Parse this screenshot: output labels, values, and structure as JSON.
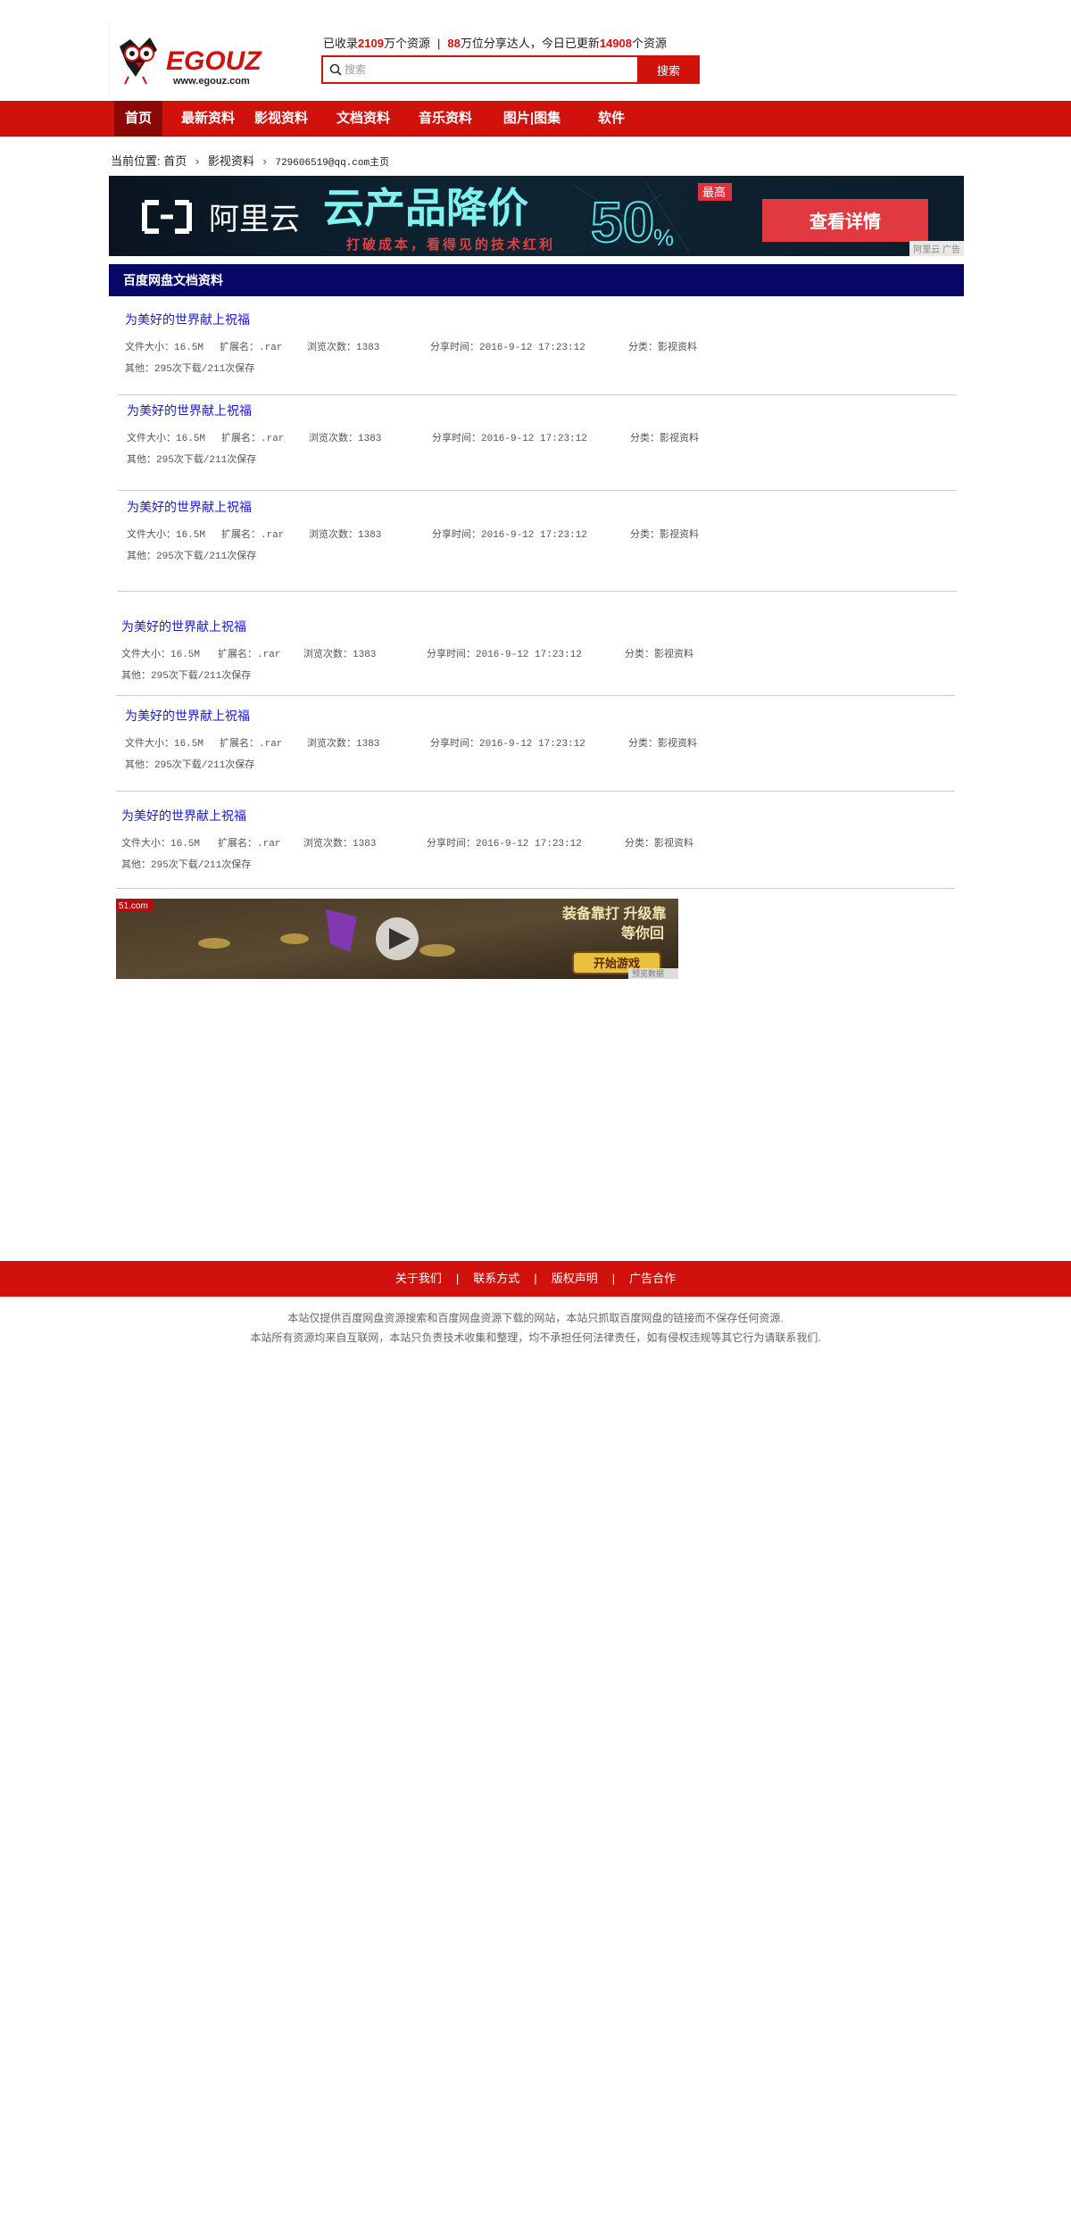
{
  "header": {
    "logo_text": "EGOUZ",
    "logo_url_text": "www.egouz.com",
    "stats": {
      "prefix": "已收录",
      "resource_count": "2109",
      "resource_suffix": "万个资源",
      "users_count": "88",
      "users_suffix": "万位分享达人，今日已更新",
      "today_count": "14908",
      "today_suffix": "个资源"
    },
    "search": {
      "placeholder": "搜索",
      "button_label": "搜索"
    }
  },
  "nav": {
    "items": [
      {
        "label": "首页",
        "active": true
      },
      {
        "label": "最新资料"
      },
      {
        "label": "影视资料"
      },
      {
        "label": "文档资料"
      },
      {
        "label": "音乐资料"
      },
      {
        "label": "图片|图集"
      },
      {
        "label": "软件"
      }
    ]
  },
  "breadcrumb": {
    "prefix": "当前位置:",
    "items": [
      "首页",
      "影视资料",
      "729606519@qq.com主页"
    ]
  },
  "banner": {
    "brand": "阿里云",
    "headline": "云产品降价",
    "percent": "50",
    "percent_sign": "%",
    "badge": "最高",
    "subline": "打破成本，看得见的技术红利",
    "cta": "查看详情",
    "ad_tag": "阿里云 广告"
  },
  "section": {
    "title": "百度网盘文档资料"
  },
  "items": [
    {
      "title": "为美好的世界献上祝福",
      "size": "文件大小：16.5M",
      "ext": "扩展名：.rar",
      "views": "浏览次数：1383",
      "time": "分享时间：2016-9-12 17:23:12",
      "category": "分类：影视资料",
      "other": "其他：295次下载/211次保存"
    },
    {
      "title": "为美好的世界献上祝福",
      "size": "文件大小：16.5M",
      "ext": "扩展名：.rar",
      "views": "浏览次数：1383",
      "time": "分享时间：2016-9-12 17:23:12",
      "category": "分类：影视资料",
      "other": "其他：295次下载/211次保存"
    },
    {
      "title": "为美好的世界献上祝福",
      "size": "文件大小：16.5M",
      "ext": "扩展名：.rar",
      "views": "浏览次数：1383",
      "time": "分享时间：2016-9-12 17:23:12",
      "category": "分类：影视资料",
      "other": "其他：295次下载/211次保存"
    },
    {
      "title": "为美好的世界献上祝福",
      "size": "文件大小：16.5M",
      "ext": "扩展名：.rar",
      "views": "浏览次数：1383",
      "time": "分享时间：2016-9-12 17:23:12",
      "category": "分类：影视资料",
      "other": "其他：295次下载/211次保存"
    },
    {
      "title": "为美好的世界献上祝福",
      "size": "文件大小：16.5M",
      "ext": "扩展名：.rar",
      "views": "浏览次数：1383",
      "time": "分享时间：2016-9-12 17:23:12",
      "category": "分类：影视资料",
      "other": "其他：295次下载/211次保存"
    },
    {
      "title": "为美好的世界献上祝福",
      "size": "文件大小：16.5M",
      "ext": "扩展名：.rar",
      "views": "浏览次数：1383",
      "time": "分享时间：2016-9-12 17:23:12",
      "category": "分类：影视资料",
      "other": "其他：295次下载/211次保存"
    }
  ],
  "game_ad": {
    "site": "51.com",
    "slogan": "装备靠打 升级靠",
    "slogan2": "等你回",
    "cta": "开始游戏",
    "ad_tag": "预览数据"
  },
  "footer": {
    "links": [
      "关于我们",
      "联系方式",
      "版权声明",
      "广告合作"
    ],
    "line1": "本站仅提供百度网盘资源搜索和百度网盘资源下载的网站，本站只抓取百度网盘的链接而不保存任何资源.",
    "line2": "本站所有资源均来自互联网，本站只负责技术收集和整理，均不承担任何法律责任，如有侵权违规等其它行为请联系我们."
  },
  "colors": {
    "brand_red": "#d0110c",
    "section_navy": "#070768",
    "link_blue": "#1a1ad0"
  }
}
